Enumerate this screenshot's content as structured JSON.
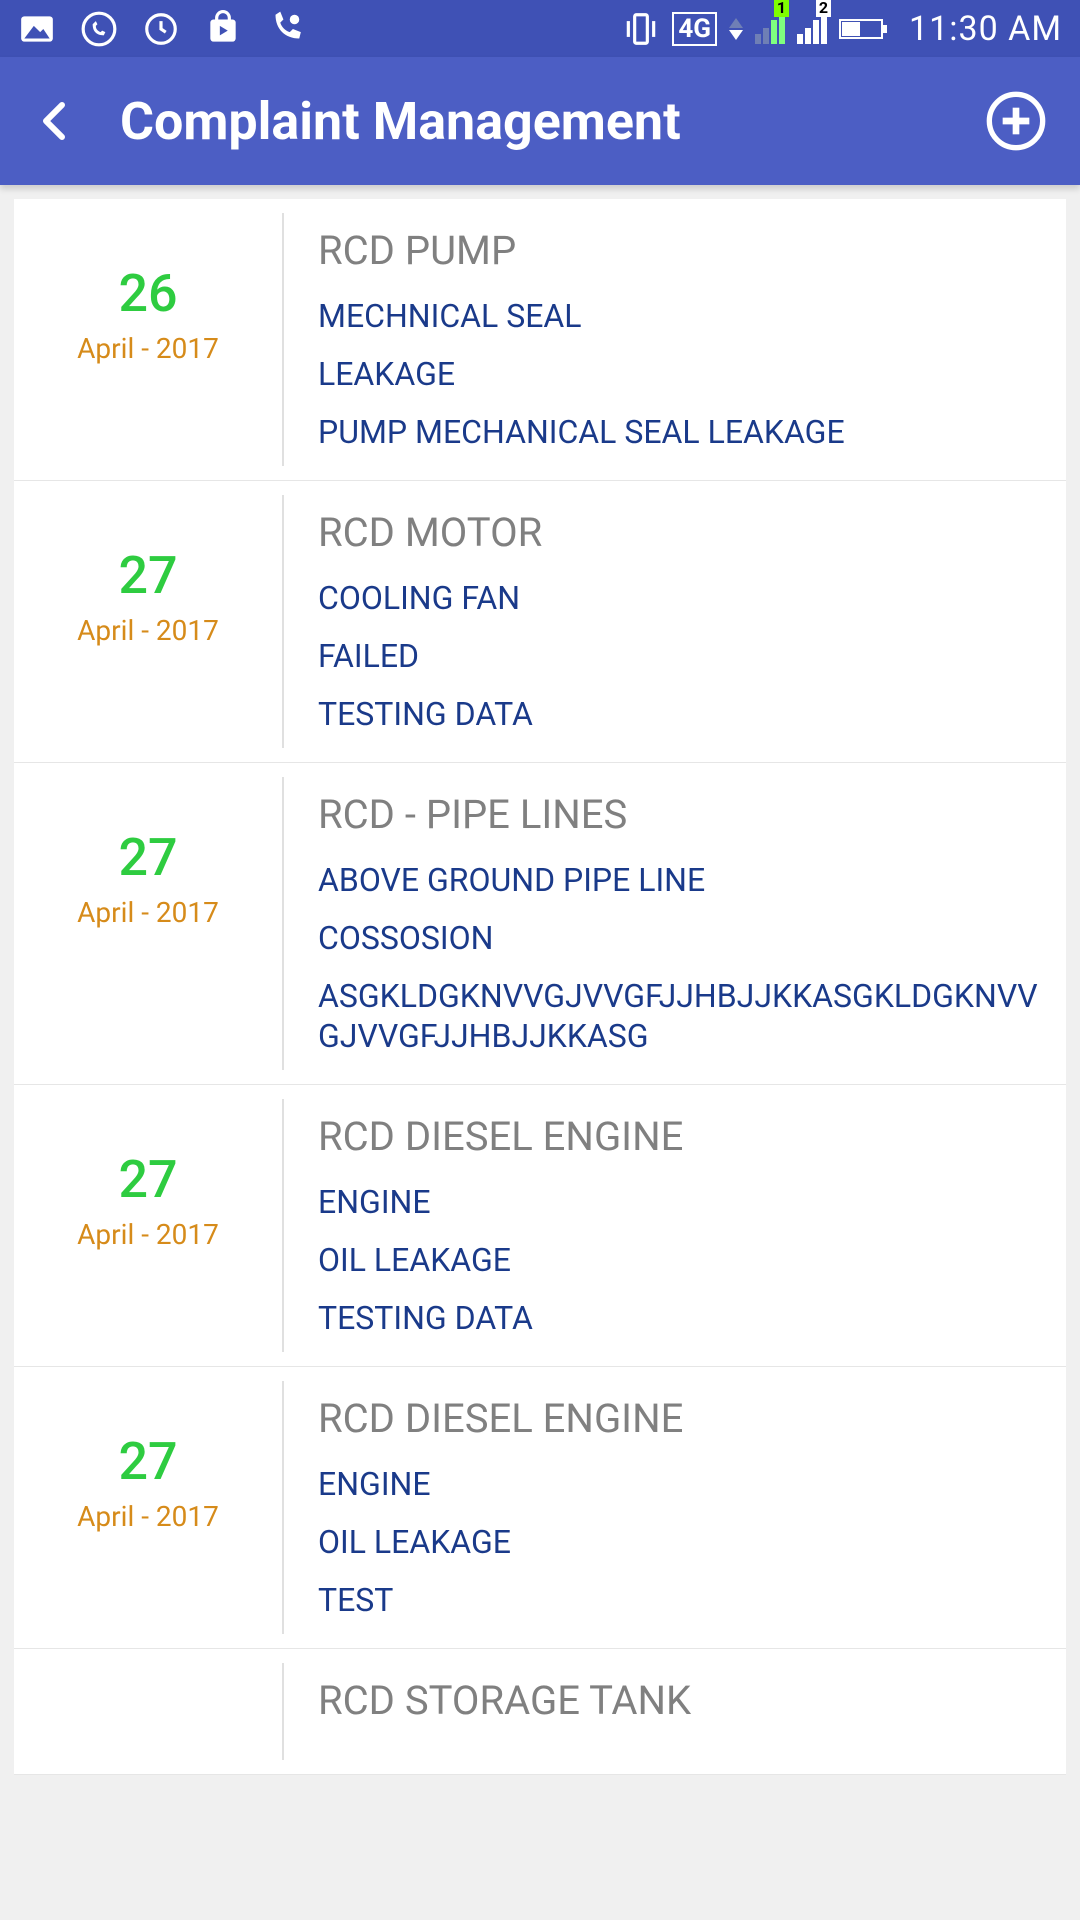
{
  "status": {
    "time": "11:30 AM",
    "network_label": "4G"
  },
  "header": {
    "title": "Complaint Management"
  },
  "complaints": [
    {
      "day": "26",
      "month": "April - 2017",
      "equipment": "RCD PUMP",
      "line1": "MECHNICAL SEAL",
      "line2": "LEAKAGE",
      "line3": "PUMP MECHANICAL SEAL LEAKAGE"
    },
    {
      "day": "27",
      "month": "April - 2017",
      "equipment": "RCD MOTOR",
      "line1": "COOLING FAN",
      "line2": "FAILED",
      "line3": "TESTING DATA"
    },
    {
      "day": "27",
      "month": "April - 2017",
      "equipment": "RCD - PIPE LINES",
      "line1": "ABOVE GROUND PIPE LINE",
      "line2": "COSSOSION",
      "line3": "ASGKLDGKNVVGJVVGFJJHBJJKKASGKLDGKNVVGJVVGFJJHBJJKKASG"
    },
    {
      "day": "27",
      "month": "April - 2017",
      "equipment": "RCD DIESEL ENGINE",
      "line1": "ENGINE",
      "line2": "OIL LEAKAGE",
      "line3": "TESTING DATA"
    },
    {
      "day": "27",
      "month": "April - 2017",
      "equipment": "RCD DIESEL ENGINE",
      "line1": "ENGINE",
      "line2": "OIL LEAKAGE",
      "line3": "TEST"
    },
    {
      "day": "",
      "month": "",
      "equipment": "RCD STORAGE TANK",
      "line1": "",
      "line2": "",
      "line3": ""
    }
  ]
}
